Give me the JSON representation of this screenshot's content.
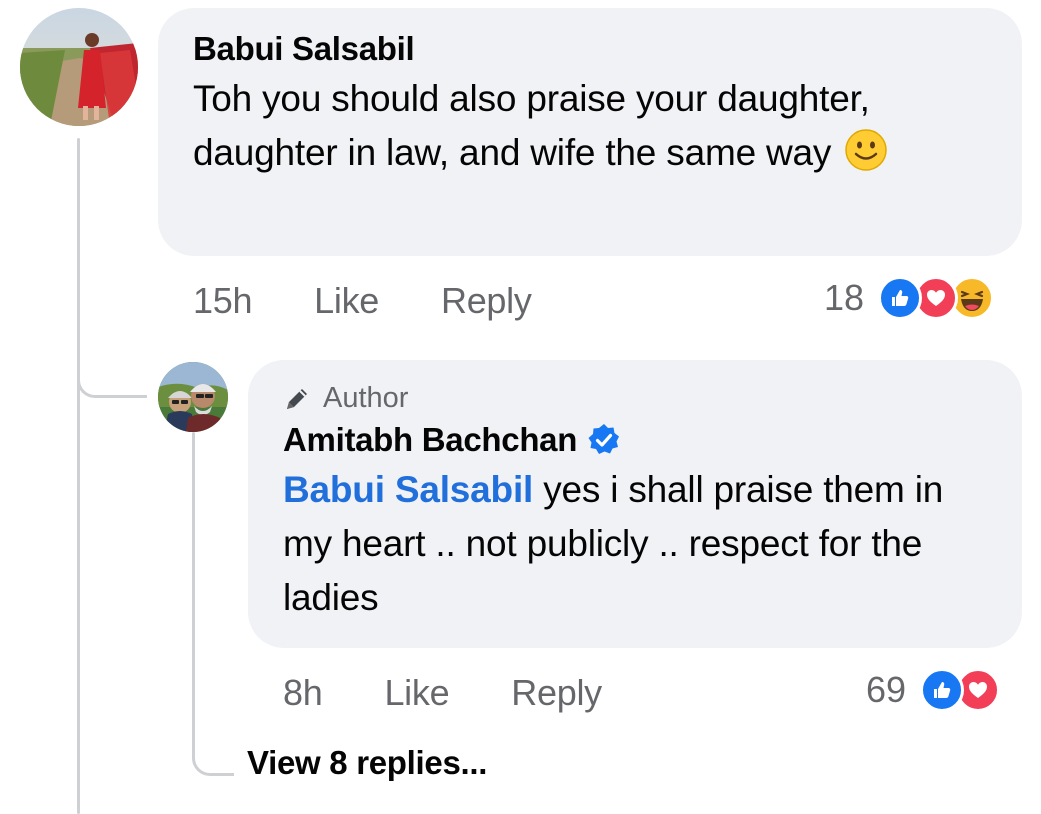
{
  "comment": {
    "author": "Babui Salsabil",
    "text": "Toh you should also praise your daughter, daughter in law, and wife the same way",
    "emoji": "smiling-face",
    "time": "15h",
    "like_label": "Like",
    "reply_label": "Reply",
    "reaction_count": "18",
    "reactions": [
      "like",
      "love",
      "haha"
    ]
  },
  "reply": {
    "badge_label": "Author",
    "author": "Amitabh Bachchan",
    "verified": true,
    "mention": "Babui Salsabil",
    "text": " yes i shall praise them in my heart .. not publicly .. respect for the ladies",
    "time": "8h",
    "like_label": "Like",
    "reply_label": "Reply",
    "reaction_count": "69",
    "reactions": [
      "like",
      "love"
    ]
  },
  "view_replies_label": "View 8 replies...",
  "colors": {
    "bubble": "#f0f2f5",
    "meta_text": "#65676b",
    "mention": "#216fdb",
    "like_blue": "#1877f2",
    "love_red": "#f33e58",
    "haha_yellow": "#f7b928",
    "thread_line": "#ced0d4"
  }
}
